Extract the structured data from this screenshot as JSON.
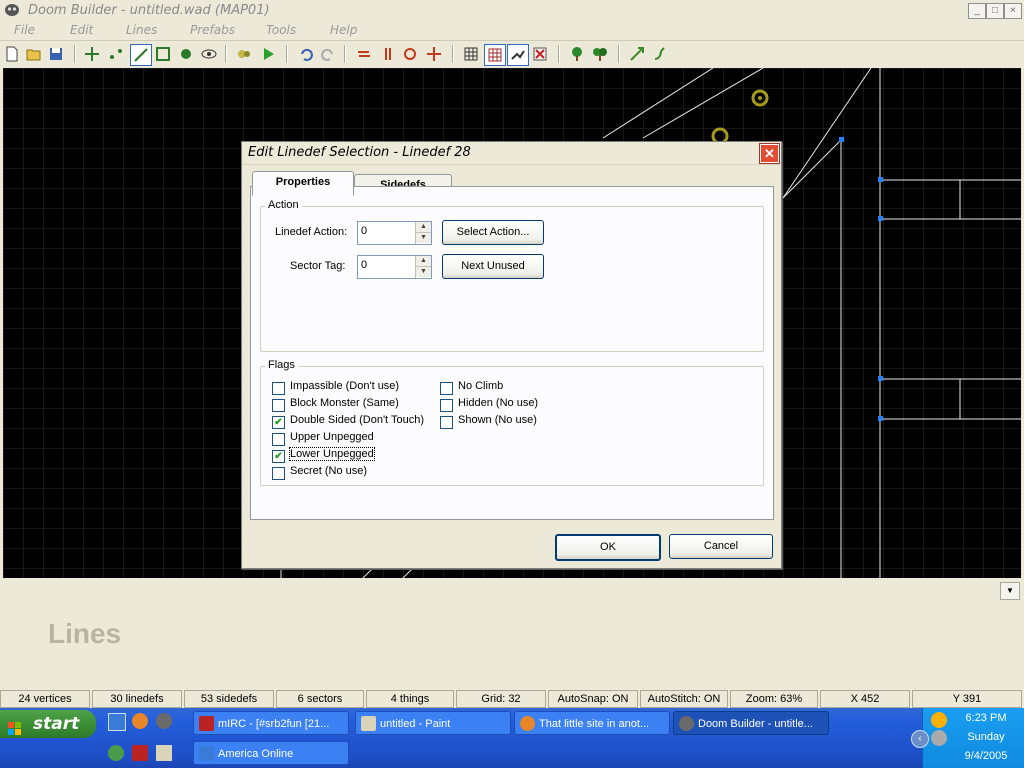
{
  "window": {
    "title": "Doom Builder - untitled.wad (MAP01)",
    "minimize": "_",
    "maximize": "□",
    "close": "×"
  },
  "menu": [
    "File",
    "Edit",
    "Lines",
    "Prefabs",
    "Tools",
    "Help"
  ],
  "toolbar_icons": [
    "new-icon",
    "open-icon",
    "save-icon",
    "move-mode-icon",
    "vertices-mode-icon",
    "lines-mode-icon",
    "sectors-mode-icon",
    "things-mode-icon",
    "3d-mode-icon",
    "build-nodes-icon",
    "test-map-icon",
    "undo-icon",
    "redo-icon",
    "flip-linedefs-icon",
    "flip-sidedefs-icon",
    "rotate-icon",
    "resize-icon",
    "grid-icon",
    "snap-grid-icon",
    "stitch-icon",
    "delete-icon",
    "tree-icon",
    "tree2-icon",
    "tool-a-icon",
    "tool-b-icon"
  ],
  "mode_label": "Lines",
  "dialog": {
    "title": "Edit Linedef Selection - Linedef 28",
    "tabs": [
      "Properties",
      "Sidedefs"
    ],
    "action_group": "Action",
    "linedef_action_label": "Linedef Action:",
    "linedef_action_value": "0",
    "select_action_button": "Select Action...",
    "sector_tag_label": "Sector Tag:",
    "sector_tag_value": "0",
    "next_unused_button": "Next Unused",
    "flags_group": "Flags",
    "flags_left": [
      {
        "label": "Impassible (Don't use)",
        "checked": false
      },
      {
        "label": "Block Monster (Same)",
        "checked": false
      },
      {
        "label": "Double Sided (Don't Touch)",
        "checked": true
      },
      {
        "label": "Upper Unpegged",
        "checked": false
      },
      {
        "label": "Lower Unpegged",
        "checked": true
      },
      {
        "label": "Secret (No use)",
        "checked": false
      }
    ],
    "flags_right": [
      {
        "label": "No Climb",
        "checked": false
      },
      {
        "label": "Hidden (No use)",
        "checked": false
      },
      {
        "label": "Shown (No use)",
        "checked": false
      }
    ],
    "ok_button": "OK",
    "cancel_button": "Cancel"
  },
  "status": [
    "24 vertices",
    "30 linedefs",
    "53 sidedefs",
    "6 sectors",
    "4 things",
    "Grid: 32",
    "AutoSnap: ON",
    "AutoStitch: ON",
    "Zoom: 63%",
    "X 452",
    "Y 391"
  ],
  "taskbar": {
    "start": "start",
    "tasks_row1": [
      "mIRC - [#srb2fun [21...",
      "untitled - Paint",
      "That little site in anot...",
      "Doom Builder - untitle..."
    ],
    "tasks_row2": [
      "America  Online"
    ],
    "clock": {
      "time": "6:23 PM",
      "day": "Sunday",
      "date": "9/4/2005"
    }
  }
}
